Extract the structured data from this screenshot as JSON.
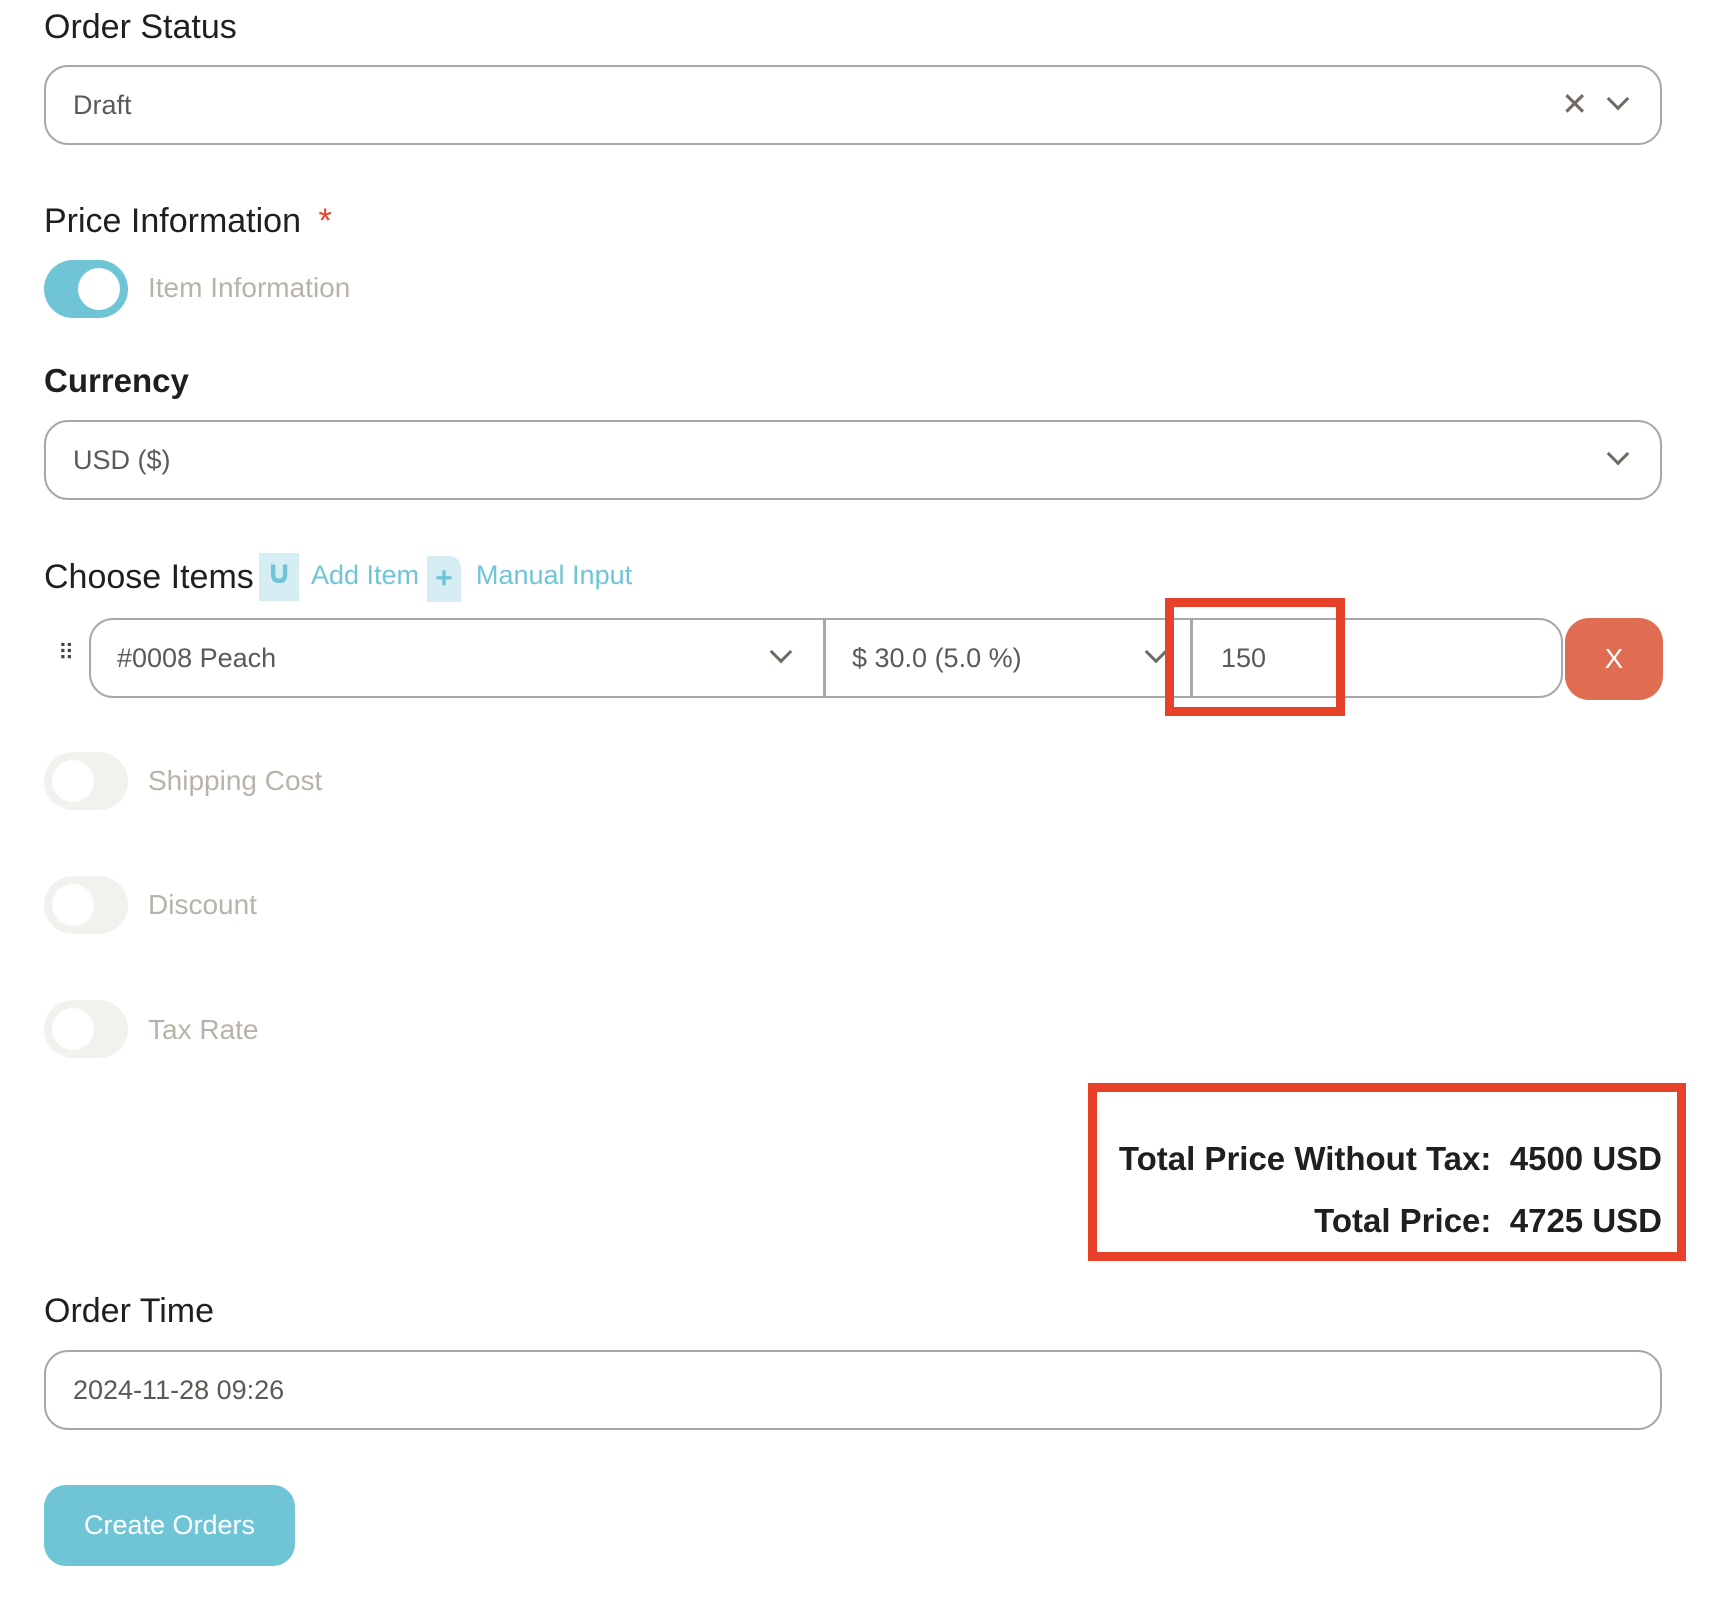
{
  "order_status": {
    "label": "Order Status",
    "value": "Draft"
  },
  "price_information": {
    "label": "Price Information",
    "required_mark": "*",
    "item_toggle_label": "Item Information",
    "item_toggle_on": true
  },
  "currency": {
    "label": "Currency",
    "value": "USD ($)"
  },
  "choose_items": {
    "label": "Choose Items",
    "add_item": "Add Item",
    "manual_input": "Manual Input",
    "rows": [
      {
        "item": "#0008 Peach",
        "price": "$ 30.0 (5.0 %)",
        "quantity": "150",
        "remove_label": "X"
      }
    ]
  },
  "toggles": [
    {
      "label": "Shipping Cost",
      "on": false
    },
    {
      "label": "Discount",
      "on": false
    },
    {
      "label": "Tax Rate",
      "on": false
    }
  ],
  "totals": {
    "without_tax_label": "Total Price Without Tax:",
    "without_tax_value": "4500 USD",
    "total_label": "Total Price:",
    "total_value": "4725 USD"
  },
  "order_time": {
    "label": "Order Time",
    "value": "2024-11-28 09:26"
  },
  "submit_label": "Create Orders",
  "colors": {
    "accent": "#6fc5d6",
    "danger": "#e06d52",
    "highlight": "#e8412a"
  }
}
